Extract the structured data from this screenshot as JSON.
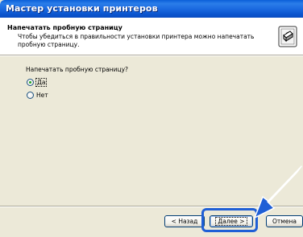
{
  "window": {
    "title": "Мастер установки принтеров"
  },
  "header": {
    "title": "Напечатать пробную страницу",
    "description": "Чтобы убедиться в правильности установки принтера можно напечатать пробную страницу.",
    "icon": "printer-wizard-icon"
  },
  "main": {
    "question": "Напечатать пробную страницу?",
    "options": [
      {
        "label": "Да",
        "checked": true
      },
      {
        "label": "Нет",
        "checked": false
      }
    ]
  },
  "buttons": {
    "back": "< Назад",
    "next": "Далее >",
    "cancel": "Отмена"
  },
  "annotation": {
    "arrow_color": "#1f5fd6",
    "arrow_icon": "blue-arrow-icon"
  }
}
